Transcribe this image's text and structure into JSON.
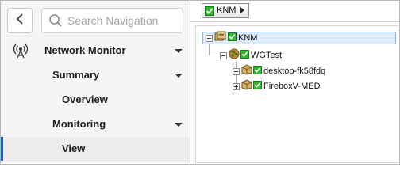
{
  "sidebar": {
    "back_icon": "chevron-left-icon",
    "search": {
      "placeholder": "Search Navigation",
      "value": ""
    },
    "items": [
      {
        "label": "Network Monitor",
        "icon": "antenna-icon"
      },
      {
        "label": "Summary"
      },
      {
        "label": "Overview"
      },
      {
        "label": "Monitoring"
      },
      {
        "label": "View",
        "active": true
      }
    ]
  },
  "toolbar": {
    "device_label": "KNM"
  },
  "tree": {
    "root": {
      "label": "KNM",
      "state": "expanded",
      "selected": true
    },
    "children": [
      {
        "label": "WGTest",
        "state": "expanded"
      },
      {
        "label": "desktop-fk58fdq",
        "state": "expanded"
      },
      {
        "label": "FireboxV-MED",
        "state": "collapsed"
      }
    ]
  },
  "colors": {
    "accent": "#1f5fbf",
    "status_ok": "#2eb82e",
    "selection": "#dbe9f9"
  }
}
